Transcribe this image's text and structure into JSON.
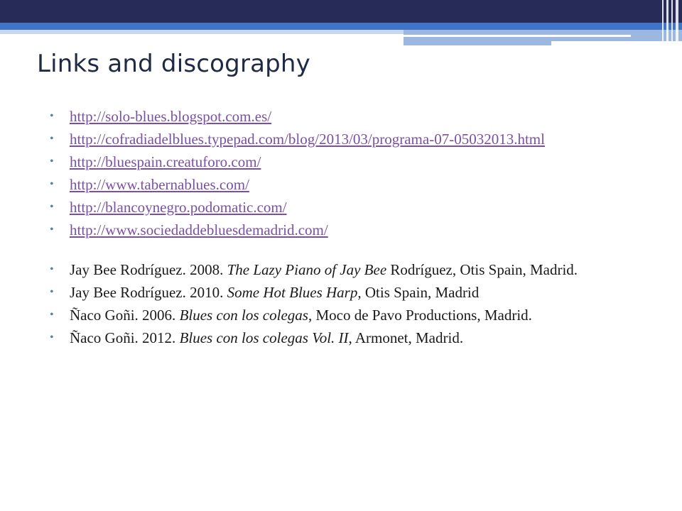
{
  "slide": {
    "title": "Links and discography",
    "accent_color": "#4f81bd",
    "link_color": "#7b4fa6",
    "links": [
      "http://solo-blues.blogspot.com.es/",
      "http://cofradiadelblues.typepad.com/blog/2013/03/programa-07-05032013.html",
      "http://bluespain.creatuforo.com/",
      "http://www.tabernablues.com/",
      "http://blancoynegro.podomatic.com/",
      "http://www.sociedaddebluesdemadrid.com/"
    ],
    "discography": [
      {
        "lead": "Jay Bee Rodríguez. 2008. ",
        "title": "The Lazy Piano of Jay Bee",
        "tail": " Rodríguez, Otis Spain, Madrid."
      },
      {
        "lead": "Jay Bee Rodríguez. 2010. ",
        "title": "Some Hot Blues Harp",
        "tail": ", Otis Spain, Madrid"
      },
      {
        "lead": "Ñaco Goñi. 2006. ",
        "title": "Blues con los colegas",
        "tail": ", Moco de Pavo Productions, Madrid."
      },
      {
        "lead": "Ñaco Goñi. 2012. ",
        "title": "Blues con los colegas Vol. II",
        "tail": ", Armonet, Madrid."
      }
    ]
  }
}
